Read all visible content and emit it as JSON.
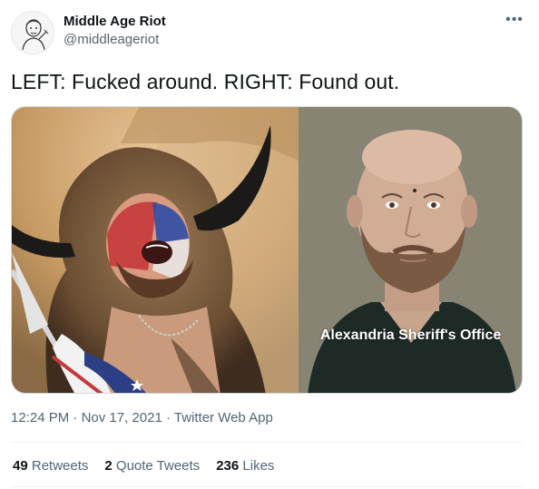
{
  "author": {
    "display_name": "Middle Age Riot",
    "handle": "@middleageriot",
    "avatar_icon": "avatar-sketch-icon"
  },
  "more_icon": "more-options-icon",
  "tweet": {
    "text": "LEFT: Fucked around. RIGHT: Found out.",
    "media_caption": "Alexandria Sheriff's Office"
  },
  "meta": {
    "time": "12:24 PM",
    "separator1": " · ",
    "date": "Nov 17, 2021",
    "separator2": " · ",
    "source": "Twitter Web App"
  },
  "stats": {
    "retweets_count": "49",
    "retweets_label": "Retweets",
    "quotes_count": "2",
    "quotes_label": "Quote Tweets",
    "likes_count": "236",
    "likes_label": "Likes"
  },
  "colors": {
    "text_primary": "#0f1419",
    "text_secondary": "#536471",
    "border": "#cfd9de",
    "divider": "#eff3f4"
  }
}
